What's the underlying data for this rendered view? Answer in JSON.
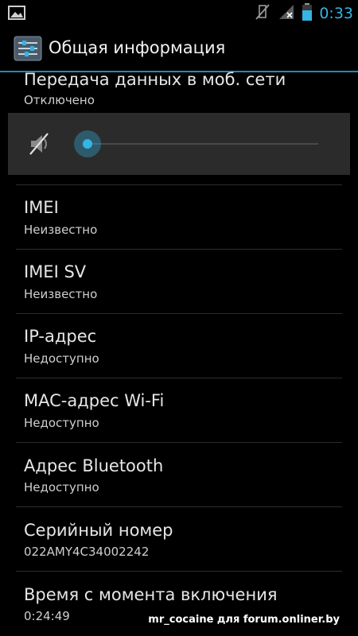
{
  "status_bar": {
    "time": "0:33",
    "icons": [
      "image-icon",
      "vibrate-mute-icon",
      "signal-icon",
      "battery-icon"
    ]
  },
  "action_bar": {
    "title": "Общая информация",
    "icon": "settings-sliders-icon"
  },
  "items": [
    {
      "title": "Передача данных в моб. сети",
      "summary": "Отключено"
    },
    {
      "title": "IMEI",
      "summary": "Неизвестно"
    },
    {
      "title": "IMEI SV",
      "summary": "Неизвестно"
    },
    {
      "title": "IP-адрес",
      "summary": "Недоступно"
    },
    {
      "title": "MAC-адрес Wi-Fi",
      "summary": "Недоступно"
    },
    {
      "title": "Адрес Bluetooth",
      "summary": "Недоступно"
    },
    {
      "title": "Серийный номер",
      "summary": "022AMY4C34002242"
    },
    {
      "title": "Время с момента включения",
      "summary": "0:24:49"
    }
  ],
  "volume_panel": {
    "icon": "volume-muted-icon",
    "level": 0.0
  },
  "colors": {
    "accent": "#33b5e5",
    "background": "#000000",
    "panel": "#2b2b2b"
  },
  "watermark": "mr_cocaine для forum.onliner.by"
}
